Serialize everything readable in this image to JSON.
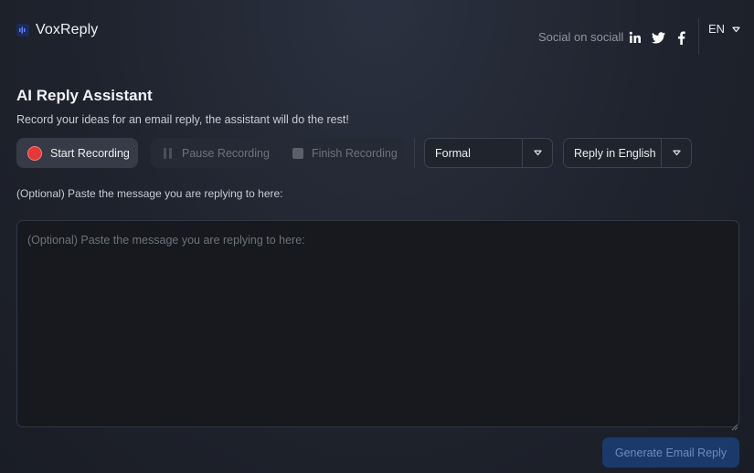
{
  "app": {
    "name": "VoxReply"
  },
  "header": {
    "social_label": "Social on sociall",
    "social_icons": [
      "linkedin-icon",
      "twitter-icon",
      "facebook-icon"
    ],
    "language": "EN"
  },
  "main": {
    "title": "AI Reply Assistant",
    "subtitle": "Record your ideas for an email reply, the assistant will do the rest!",
    "controls": {
      "start_label": "Start Recording",
      "pause_label": "Pause Recording",
      "finish_label": "Finish Recording",
      "tone_value": "Formal",
      "reply_language_value": "Reply in English"
    },
    "message_label": "(Optional) Paste the message you are replying to here:",
    "message_placeholder": "(Optional) Paste the message you are replying to here:",
    "message_value": "",
    "generate_label": "Generate Email Reply"
  },
  "colors": {
    "background": "#1f232d",
    "record_red": "#e53838",
    "accent_blue": "#1b3a6b"
  }
}
